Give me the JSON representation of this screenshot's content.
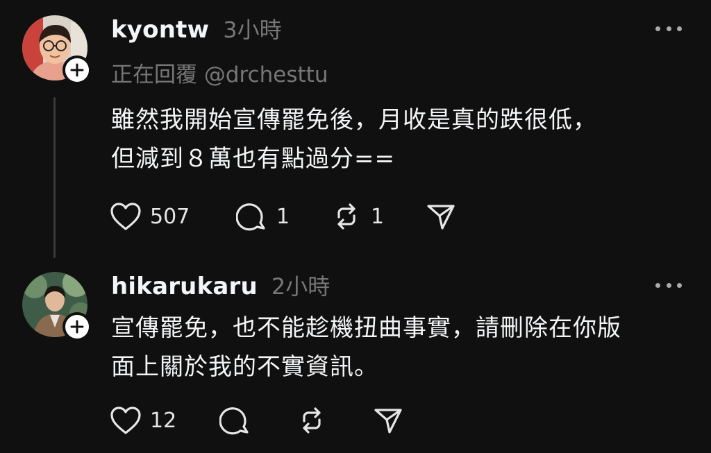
{
  "posts": [
    {
      "username": "kyontw",
      "time": "3小時",
      "reply_prefix": "正在回覆",
      "reply_to": "@drchesttu",
      "lines": [
        "雖然我開始宣傳罷免後，月收是真的跌很低，",
        "但減到８萬也有點過分=="
      ],
      "likes": "507",
      "comments": "1",
      "reposts": "1",
      "avatar_icon": "user-photo-glasses",
      "badge_icon": "plus-icon"
    },
    {
      "username": "hikarukaru",
      "time": "2小時",
      "lines": [
        "宣傳罷免，也不能趁機扭曲事實，請刪除在你版",
        "面上關於我的不實資訊。"
      ],
      "likes": "12",
      "avatar_icon": "user-photo-outdoor",
      "badge_icon": "plus-icon"
    }
  ],
  "colors": {
    "background": "#101010",
    "text": "#f3f5f7",
    "muted": "#777777",
    "thread_line": "#3a3a3a"
  }
}
